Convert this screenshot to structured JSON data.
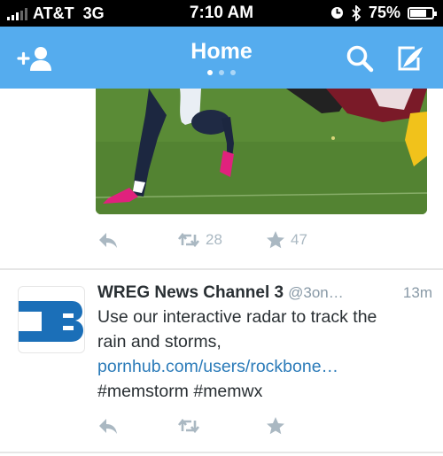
{
  "status_bar": {
    "carrier": "AT&T",
    "network": "3G",
    "time": "7:10 AM",
    "battery": "75%",
    "battery_level": 0.75
  },
  "nav": {
    "title": "Home",
    "page_count": 3,
    "active_page": 0,
    "icons": [
      "add-user-icon",
      "search-icon",
      "compose-icon"
    ],
    "bar_color": "#55acee"
  },
  "tweets": [
    {
      "retweets": "28",
      "favorites": "47"
    },
    {
      "name": "WREG News Channel 3",
      "handle": "@3on…",
      "time": "13m",
      "text_line1": "Use our interactive radar to track the",
      "text_line2": "rain and storms,",
      "link": "pornhub.com/users/rockbone…",
      "hashtags": "#memstorm #memwx"
    }
  ],
  "colors": {
    "link": "#2b7bb9",
    "action_icon": "#aab8c2",
    "avatar_brand": "#1b6fb8"
  }
}
